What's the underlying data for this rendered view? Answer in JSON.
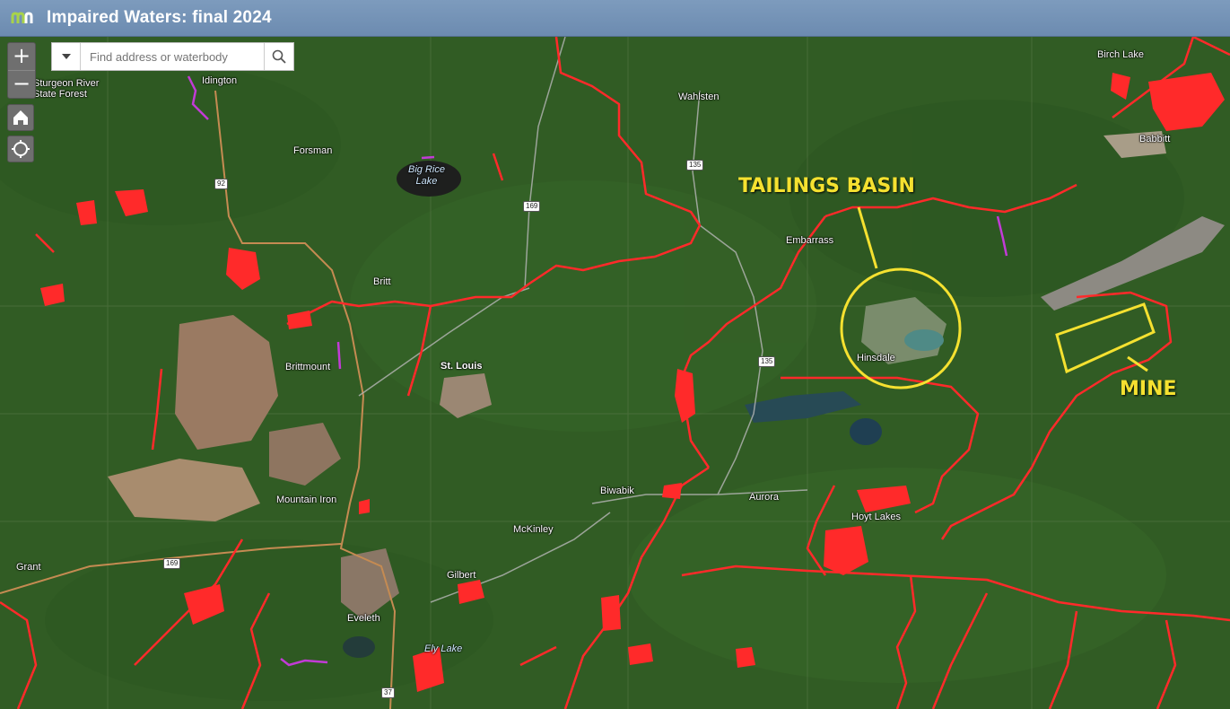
{
  "header": {
    "title": "Impaired Waters: final 2024"
  },
  "search": {
    "placeholder": "Find address or waterbody"
  },
  "controls": {
    "zoom_in": "+",
    "zoom_out": "−"
  },
  "places": {
    "sturgeon": "Sturgeon River\nState Forest",
    "idington": "Idington",
    "wahlsten": "Wahlsten",
    "birch_lake": "Birch Lake",
    "forsman": "Forsman",
    "babbitt": "Babbitt",
    "embarrass": "Embarrass",
    "britt": "Britt",
    "brittmount": "Brittmount",
    "st_louis": "St. Louis",
    "hinsdale": "Hinsdale",
    "biwabik": "Biwabik",
    "aurora": "Aurora",
    "mountain_iron": "Mountain Iron",
    "hoyt_lakes": "Hoyt Lakes",
    "mckinley": "McKinley",
    "grant": "Grant",
    "gilbert": "Gilbert",
    "eveleth": "Eveleth"
  },
  "waters": {
    "big_rice": "Big Rice\nLake",
    "ely": "Ely Lake"
  },
  "shields": {
    "s92": "92",
    "s169a": "169",
    "s135a": "135",
    "s135b": "135",
    "s169b": "169",
    "s37": "37"
  },
  "annotations": {
    "tailings": "TAILINGS BASIN",
    "mine": "MINE"
  },
  "colors": {
    "impaired": "#ff2a2a",
    "impaired_other": "#c23bd6",
    "annotation": "#f5e130",
    "header": "#7590b4"
  }
}
